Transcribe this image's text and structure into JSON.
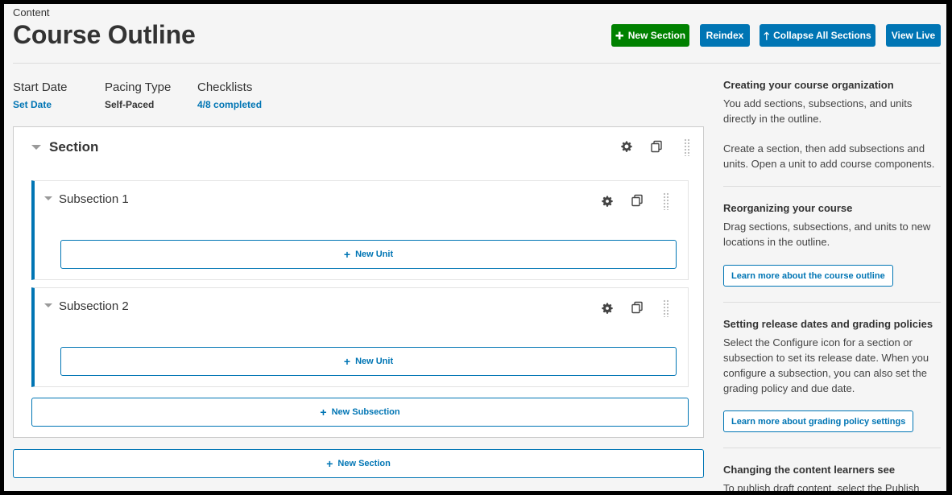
{
  "header": {
    "breadcrumb": "Content",
    "title": "Course Outline",
    "buttons": {
      "new_section": "New Section",
      "reindex": "Reindex",
      "collapse_all": "Collapse All Sections",
      "view_live": "View Live"
    }
  },
  "meta": {
    "start_date": {
      "label": "Start Date",
      "value": "Set Date"
    },
    "pacing_type": {
      "label": "Pacing Type",
      "value": "Self-Paced"
    },
    "checklists": {
      "label": "Checklists",
      "value": "4/8 completed"
    }
  },
  "outline": {
    "section": {
      "title": "Section",
      "subsections": [
        {
          "title": "Subsection 1",
          "new_unit_label": "New Unit"
        },
        {
          "title": "Subsection 2",
          "new_unit_label": "New Unit"
        }
      ],
      "new_subsection_label": "New Subsection"
    },
    "new_section_label": "New Section"
  },
  "sidebar": {
    "blocks": [
      {
        "heading": "Creating your course organization",
        "paragraphs": [
          "You add sections, subsections, and units directly in the outline.",
          "Create a section, then add subsections and units. Open a unit to add course components."
        ]
      },
      {
        "heading": "Reorganizing your course",
        "paragraphs": [
          "Drag sections, subsections, and units to new locations in the outline."
        ],
        "button": "Learn more about the course outline"
      },
      {
        "heading": "Setting release dates and grading policies",
        "paragraphs": [
          "Select the Configure icon for a section or subsection to set its release date. When you configure a subsection, you can also set the grading policy and due date."
        ],
        "button": "Learn more about grading policy settings"
      },
      {
        "heading": "Changing the content learners see",
        "paragraphs": [
          "To publish draft content, select the Publish"
        ]
      }
    ]
  },
  "colors": {
    "primary": "#0075b4",
    "success": "#008100"
  },
  "icons": [
    "plus-icon",
    "arrow-up-icon",
    "gear-icon",
    "duplicate-icon",
    "drag-handle-icon",
    "caret-down-icon"
  ]
}
